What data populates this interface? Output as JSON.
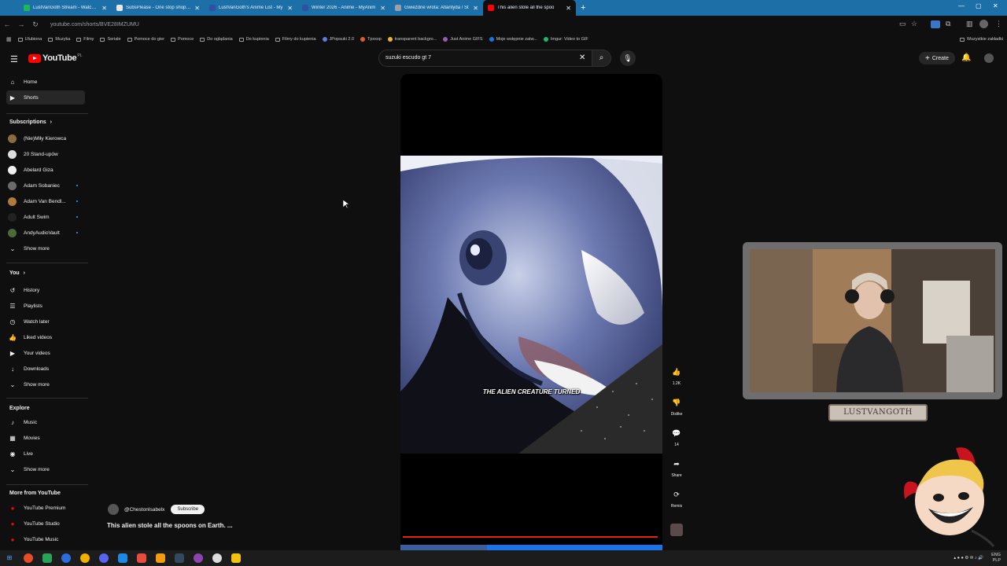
{
  "browser": {
    "tabs": [
      {
        "label": "LustVanGoth Stream - Watch Liv",
        "icon": "twitch-favicon",
        "color": "#1db954"
      },
      {
        "label": "SubsPlease - One stop shop for",
        "icon": "subsplease-favicon",
        "color": "#e8e8e8"
      },
      {
        "label": "LustVanGoth's Anime List - My",
        "icon": "mal-favicon",
        "color": "#2e51a2"
      },
      {
        "label": "Winter 2026 - Anime - MyAnim",
        "icon": "mal-favicon",
        "color": "#2e51a2"
      },
      {
        "label": "Gwiezdne wrota: Atlantyda / St",
        "icon": "globe-favicon",
        "color": "#9aa0a6"
      },
      {
        "label": "This alien stole all the spoo",
        "icon": "youtube-favicon",
        "color": "#ff0000"
      }
    ],
    "new_tab": "+",
    "url": "youtube.com/shorts/BVE28IMZUMU",
    "bookmarks": [
      {
        "label": "Ulubiona",
        "type": "folder"
      },
      {
        "label": "Muzyka",
        "type": "folder"
      },
      {
        "label": "Filmy",
        "type": "folder"
      },
      {
        "label": "Seriale",
        "type": "folder"
      },
      {
        "label": "Pomoce do gier",
        "type": "folder"
      },
      {
        "label": "Pomoce",
        "type": "folder"
      },
      {
        "label": "Do oglądania",
        "type": "folder"
      },
      {
        "label": "Do kupienia",
        "type": "folder"
      },
      {
        "label": "Filmy do kupienia",
        "type": "folder"
      },
      {
        "label": "JPopsuki 2.0",
        "type": "site",
        "color": "#5b7fd6"
      },
      {
        "label": "Tpxxxp",
        "type": "site",
        "color": "#e05a2b"
      },
      {
        "label": "transparent backgro...",
        "type": "site",
        "color": "#f2b134"
      },
      {
        "label": "Just Anime GIFS",
        "type": "site",
        "color": "#9b59b6"
      },
      {
        "label": "Moje wstępnie zatw...",
        "type": "site",
        "color": "#1a73e8"
      },
      {
        "label": "Imgur: Video to GIF",
        "type": "site",
        "color": "#1bb76e"
      }
    ],
    "all_bookmarks": "Wszystkie zakładki"
  },
  "youtube": {
    "logo_text": "YouTube",
    "logo_region": "PL",
    "search_value": "suzuki escudo gt 7",
    "create_label": "Create",
    "sidebar": {
      "main": [
        {
          "label": "Home",
          "icon": "home-icon",
          "glyph": "⌂"
        },
        {
          "label": "Shorts",
          "icon": "shorts-icon",
          "glyph": "▶"
        }
      ],
      "subscriptions_header": "Subscriptions",
      "subscriptions": [
        {
          "label": "(Nie)Miły Kierowca",
          "color": "#8a6d3b",
          "live": false
        },
        {
          "label": "20 Stand-upów",
          "color": "#dddddd",
          "live": false
        },
        {
          "label": "Abelard Giza",
          "color": "#f0f0f0",
          "live": false
        },
        {
          "label": "Adam Sobaniec",
          "color": "#6b6b6b",
          "live": true
        },
        {
          "label": "Adam Van Bendl...",
          "color": "#b07a3c",
          "live": true
        },
        {
          "label": "Adult Swim",
          "color": "#222222",
          "live": true
        },
        {
          "label": "AndyAudioVault",
          "color": "#4a6a3a",
          "live": true
        }
      ],
      "show_more": "Show more",
      "you_header": "You",
      "you_items": [
        {
          "label": "History",
          "icon": "history-icon",
          "glyph": "↺"
        },
        {
          "label": "Playlists",
          "icon": "playlists-icon",
          "glyph": "☰"
        },
        {
          "label": "Watch later",
          "icon": "watch-later-icon",
          "glyph": "◷"
        },
        {
          "label": "Liked videos",
          "icon": "liked-icon",
          "glyph": "👍"
        },
        {
          "label": "Your videos",
          "icon": "your-videos-icon",
          "glyph": "▶"
        },
        {
          "label": "Downloads",
          "icon": "downloads-icon",
          "glyph": "↓"
        }
      ],
      "explore_header": "Explore",
      "explore_items": [
        {
          "label": "Music",
          "icon": "music-icon",
          "glyph": "♪"
        },
        {
          "label": "Movies",
          "icon": "movies-icon",
          "glyph": "▦"
        },
        {
          "label": "Live",
          "icon": "live-icon",
          "glyph": "◉"
        }
      ],
      "more_header": "More from YouTube",
      "more_items": [
        {
          "label": "YouTube Premium"
        },
        {
          "label": "YouTube Studio"
        },
        {
          "label": "YouTube Music"
        }
      ]
    },
    "short": {
      "caption": "THE ALIEN CREATURE TURNED",
      "progress": 0.99,
      "channel": "@ChestonIsabelx",
      "subscribe": "Subscribe",
      "title": "This alien stole all the spoons on Earth. ...",
      "actions": [
        {
          "icon": "like-icon",
          "glyph": "👍",
          "label": "1.2K"
        },
        {
          "icon": "dislike-icon",
          "glyph": "👎",
          "label": "Dislike"
        },
        {
          "icon": "comment-icon",
          "glyph": "💬",
          "label": "14"
        },
        {
          "icon": "share-icon",
          "glyph": "➦",
          "label": "Share"
        },
        {
          "icon": "remix-icon",
          "glyph": "⟳",
          "label": "Remix"
        }
      ]
    }
  },
  "overlay": {
    "streamer_name": "LUSTVANGOTH"
  },
  "taskbar": {
    "lang": "ENG",
    "lang2": "PLP"
  }
}
